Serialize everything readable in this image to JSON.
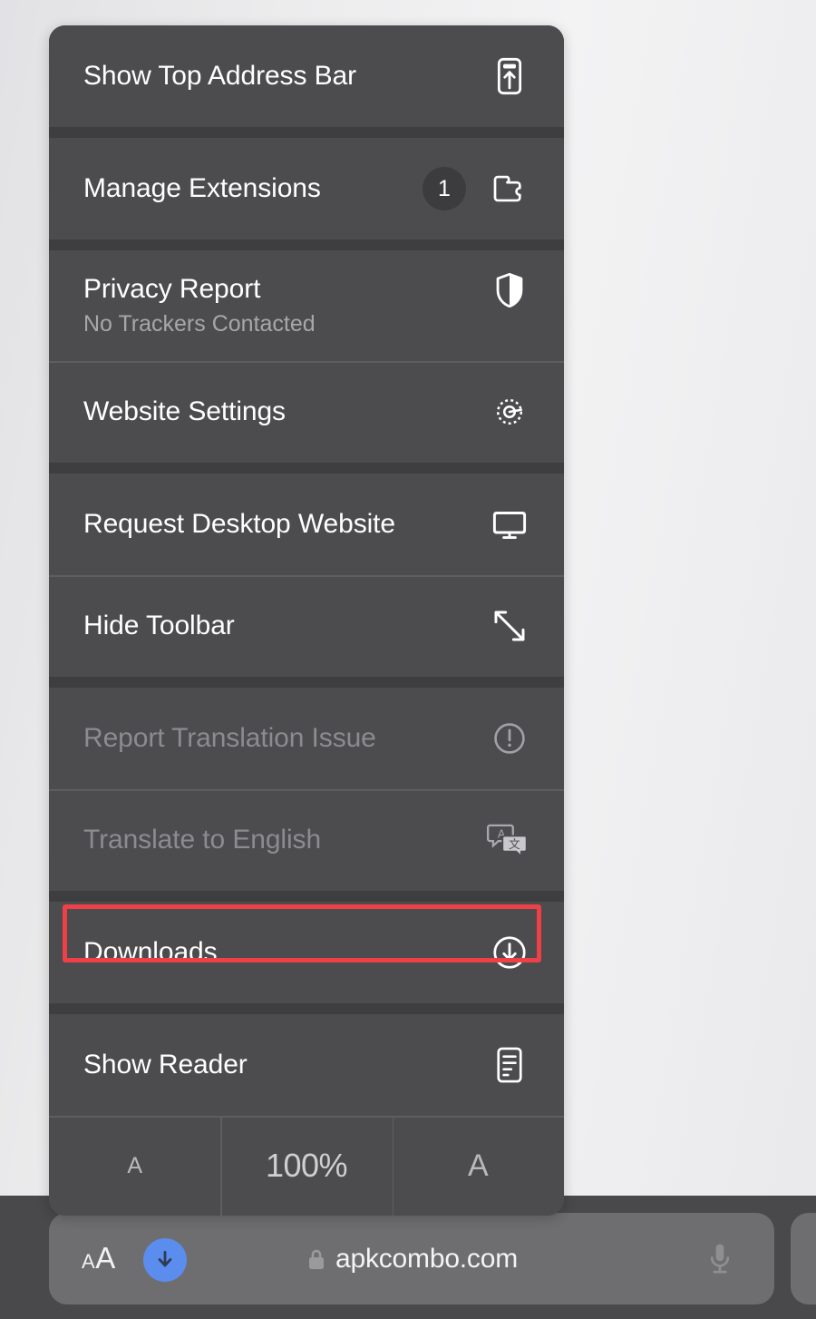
{
  "menu": {
    "groups": [
      {
        "items": [
          {
            "label": "Show Top Address Bar",
            "icon": "address-bar-top-icon",
            "enabled": true
          }
        ]
      },
      {
        "items": [
          {
            "label": "Manage Extensions",
            "badge": "1",
            "icon": "puzzle-piece-icon",
            "enabled": true
          }
        ]
      },
      {
        "items": [
          {
            "label": "Privacy Report",
            "subtitle": "No Trackers Contacted",
            "icon": "shield-icon",
            "enabled": true
          },
          {
            "label": "Website Settings",
            "icon": "gear-icon",
            "enabled": true
          }
        ]
      },
      {
        "items": [
          {
            "label": "Request Desktop Website",
            "icon": "desktop-monitor-icon",
            "enabled": true
          },
          {
            "label": "Hide Toolbar",
            "icon": "expand-arrows-icon",
            "enabled": true
          }
        ]
      },
      {
        "items": [
          {
            "label": "Report Translation Issue",
            "icon": "exclamation-circle-icon",
            "enabled": false
          },
          {
            "label": "Translate to English",
            "icon": "translate-icon",
            "enabled": false
          }
        ]
      },
      {
        "items": [
          {
            "label": "Downloads",
            "icon": "download-circle-icon",
            "enabled": true,
            "highlighted": true
          }
        ]
      },
      {
        "items": [
          {
            "label": "Show Reader",
            "icon": "reader-document-icon",
            "enabled": true
          }
        ]
      }
    ],
    "zoom": {
      "decrease_label": "A",
      "level": "100%",
      "increase_label": "A"
    }
  },
  "toolbar": {
    "text_size_small": "A",
    "text_size_large": "A",
    "download_icon": "download-arrow-icon",
    "lock_icon": "lock-icon",
    "url": "apkcombo.com",
    "mic_icon": "microphone-icon"
  },
  "annotation": {
    "target": "Downloads",
    "color": "#ef4048"
  },
  "colors": {
    "menu_background": "#4c4b4e",
    "group_separator": "#3e3d40",
    "divider": "#5e5d60",
    "label": "#ffffff",
    "label_disabled": "#8c8b8f",
    "subtitle": "#a7a6a9",
    "toolbar_background": "#49484a",
    "tab_pill": "#6e6d6f",
    "download_accent": "#5b8def",
    "highlight": "#ef4048"
  }
}
